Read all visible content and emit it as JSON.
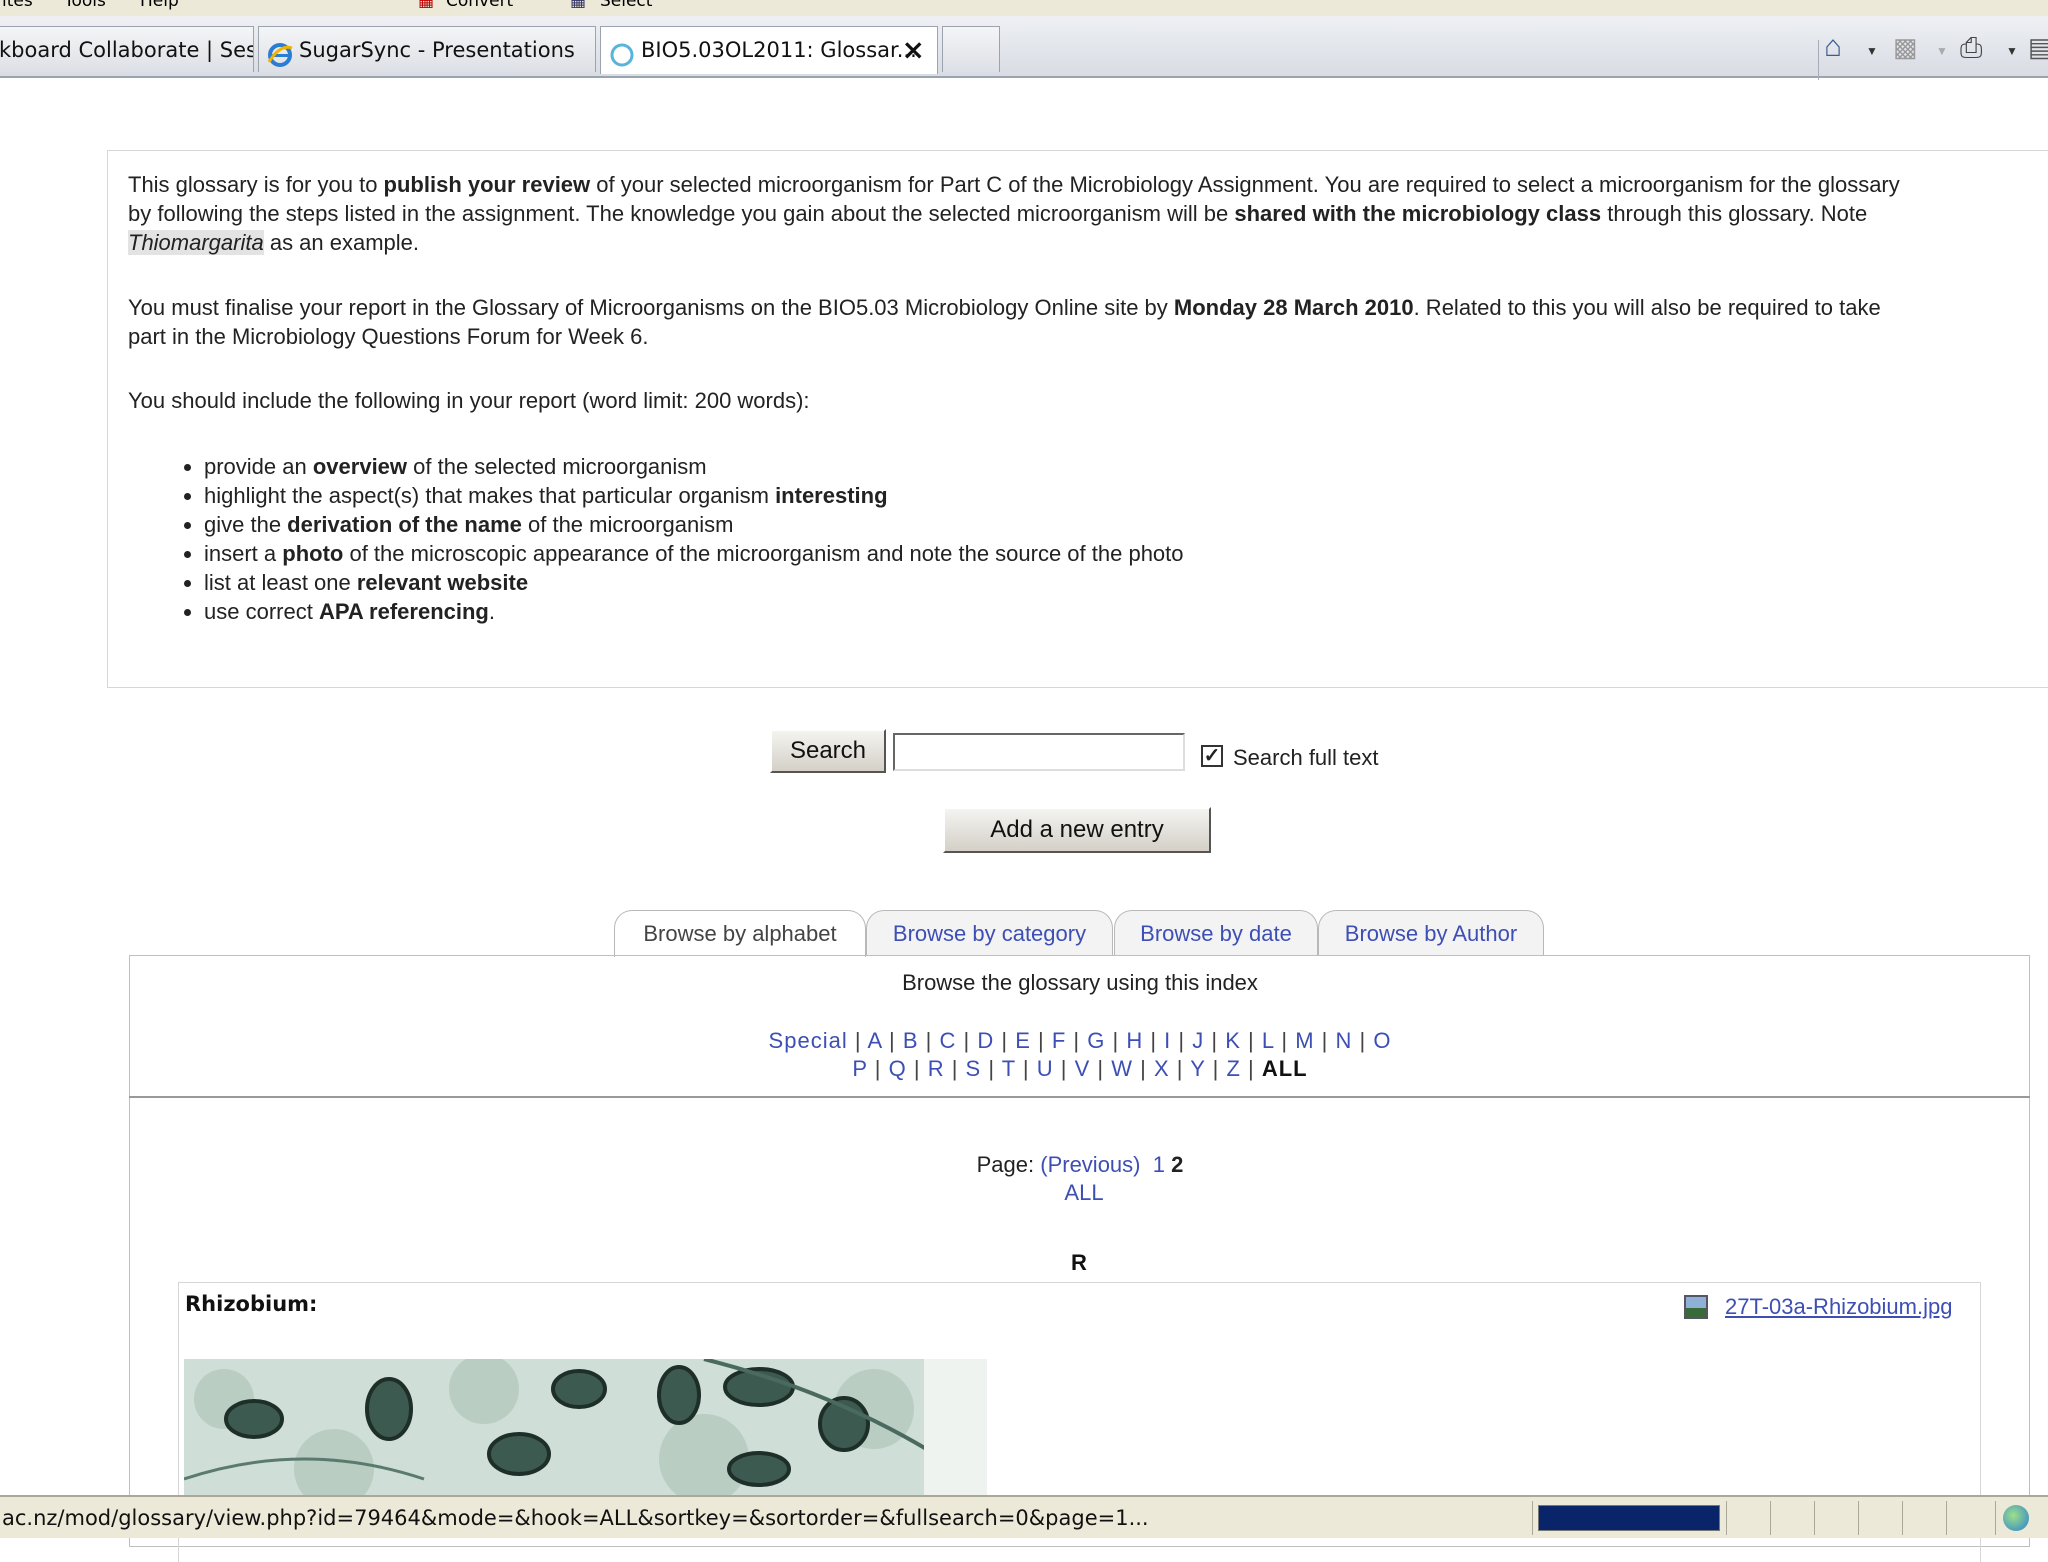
{
  "menubar": {
    "items": [
      "ites",
      "Tools",
      "Help"
    ],
    "toolbar": [
      "Convert",
      "Select"
    ]
  },
  "browser": {
    "tabs": [
      {
        "label": "kboard Collaborate | Ses...",
        "icon": "page-icon"
      },
      {
        "label": "SugarSync - Presentations",
        "icon": "ie-icon"
      },
      {
        "label": "BIO5.03OL2011: Glossar...",
        "icon": "loading-icon",
        "active": true
      },
      {
        "label": "",
        "icon": "new-tab"
      }
    ],
    "commands": [
      "home-icon",
      "feeds-icon",
      "print-icon",
      "page-icon"
    ]
  },
  "intro": {
    "p1": {
      "a": "This glossary is for you to ",
      "b": "publish your review",
      "c": " of your selected microorganism for Part C of the Microbiology Assignment. You are required to select a microorganism for the glossary",
      "d": "by following the steps listed in the assignment. The knowledge you gain about the selected microorganism will be ",
      "e": "shared with the microbiology class",
      "f": " through this glossary. Note",
      "g": "Thiomargarita",
      "h": " as an example."
    },
    "p2": {
      "a": "You must finalise your report in the Glossary of Microorganisms on the BIO5.03 Microbiology Online site by ",
      "b": "Monday 28 March 2010",
      "c": ". Related to this you will also be required to take",
      "d": "part in the Microbiology Questions Forum for Week 6."
    },
    "p3": "You should include the following in your report (word limit: 200 words):",
    "requirements": [
      {
        "pre": "provide an ",
        "bold": "overview",
        "post": " of the selected microorganism"
      },
      {
        "pre": "highlight the aspect(s) that makes that particular organism ",
        "bold": "interesting",
        "post": ""
      },
      {
        "pre": "give the ",
        "bold": "derivation of the name",
        "post": " of the microorganism"
      },
      {
        "pre": "insert a ",
        "bold": "photo",
        "post": " of the microscopic appearance of the microorganism and note the source of the photo"
      },
      {
        "pre": "list at least one ",
        "bold": "relevant website",
        "post": ""
      },
      {
        "pre": "use correct ",
        "bold": "APA referencing",
        "post": "."
      }
    ]
  },
  "search": {
    "button": "Search",
    "value": "",
    "fulltext_checked": true,
    "fulltext_label": "Search full text"
  },
  "add_entry": "Add a new entry",
  "browse_tabs": [
    "Browse by alphabet",
    "Browse by category",
    "Browse by date",
    "Browse by Author"
  ],
  "index": {
    "title": "Browse the glossary using this index",
    "row1": [
      "Special",
      "A",
      "B",
      "C",
      "D",
      "E",
      "F",
      "G",
      "H",
      "I",
      "J",
      "K",
      "L",
      "M",
      "N",
      "O"
    ],
    "row2": [
      "P",
      "Q",
      "R",
      "S",
      "T",
      "U",
      "V",
      "W",
      "X",
      "Y",
      "Z"
    ],
    "current": "ALL"
  },
  "pager": {
    "label": "Page:",
    "previous": "(Previous)",
    "pages": [
      "1",
      "2"
    ],
    "current": "2",
    "all": "ALL"
  },
  "letter_heading": "R",
  "entry": {
    "title": "Rhizobium:",
    "attachment": "27T-03a-Rhizobium.jpg"
  },
  "statusbar": {
    "url": "ac.nz/mod/glossary/view.php?id=79464&mode=&hook=ALL&sortkey=&sortorder=&fullsearch=0&page=1..."
  },
  "colors": {
    "link": "#3d4fb4",
    "chrome": "#ece9d8",
    "progress": "#0a246a"
  }
}
